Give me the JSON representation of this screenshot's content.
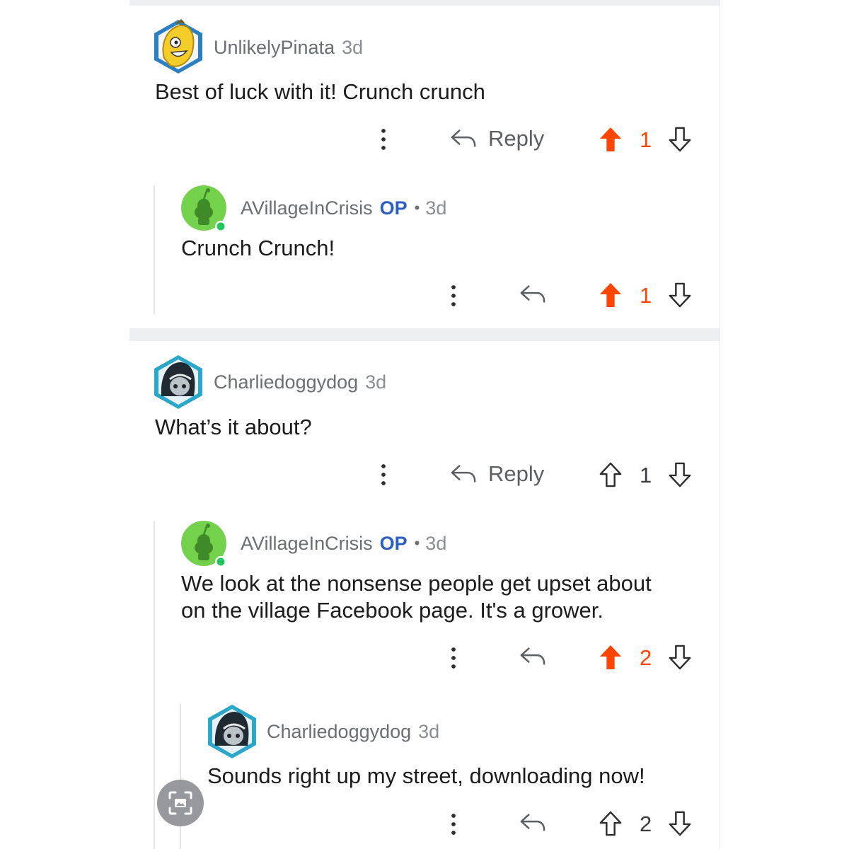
{
  "comments": [
    {
      "username": "UnlikelyPinata",
      "age": "3d",
      "body": "Best of luck with it! Crunch crunch",
      "reply_label": "Reply",
      "votes": "1",
      "avatar": "banana-avatar-icon"
    },
    {
      "username": "AVillageInCrisis",
      "op": "OP",
      "separator": "•",
      "age": "3d",
      "body": "Crunch Crunch!",
      "votes": "1",
      "avatar": "snoo-avatar-icon"
    },
    {
      "username": "Charliedoggydog",
      "age": "3d",
      "body": "What’s it about?",
      "reply_label": "Reply",
      "votes": "1",
      "avatar": "hooded-avatar-icon"
    },
    {
      "username": "AVillageInCrisis",
      "op": "OP",
      "separator": "•",
      "age": "3d",
      "body_lines": [
        "We look at the nonsense people get upset about",
        "on the village Facebook page. It's a grower."
      ],
      "votes": "2",
      "avatar": "snoo-avatar-icon"
    },
    {
      "username": "Charliedoggydog",
      "age": "3d",
      "body": "Sounds right up my street, downloading now!",
      "votes": "2",
      "avatar": "hooded-avatar-icon"
    }
  ],
  "colors": {
    "upvote_active": "#ff4500",
    "op_badge": "#2c5fbf",
    "online_dot": "#22c55e"
  },
  "icons": [
    "more-options-icon",
    "reply-arrow-icon",
    "upvote-arrow-icon",
    "downvote-arrow-icon",
    "screenshot-capture-icon"
  ]
}
